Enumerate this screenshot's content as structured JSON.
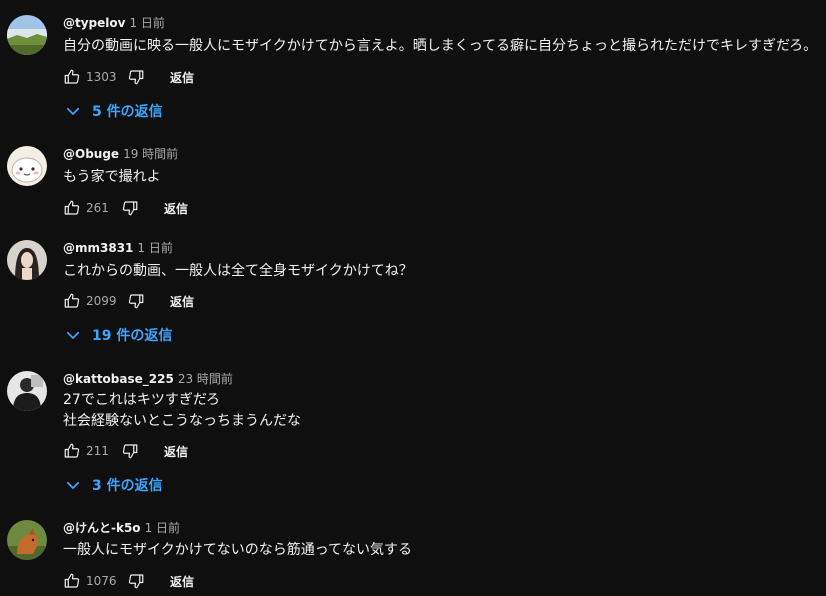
{
  "labels": {
    "reply": "返信"
  },
  "comments": [
    {
      "author": "@typelov",
      "time": "1 日前",
      "lines": [
        "自分の動画に映る一般人にモザイクかけてから言えよ。晒しまくってる癖に自分ちょっと撮られただけでキレすぎだろ。"
      ],
      "likes": "1303",
      "replies": "5 件の返信"
    },
    {
      "author": "@Obuge",
      "time": "19 時間前",
      "lines": [
        "もう家で撮れよ"
      ],
      "likes": "261"
    },
    {
      "author": "@mm3831",
      "time": "1 日前",
      "lines": [
        "これからの動画、一般人は全て全身モザイクかけてね？"
      ],
      "likes": "2099",
      "replies": "19 件の返信"
    },
    {
      "author": "@kattobase_225",
      "time": "23 時間前",
      "lines": [
        "27でこれはキツすぎだろ",
        "社会経験ないとこうなっちまうんだな"
      ],
      "likes": "211",
      "replies": "3 件の返信"
    },
    {
      "author": "@けんと-k5o",
      "time": "1 日前",
      "lines": [
        "一般人にモザイクかけてないのなら筋通ってない気する"
      ],
      "likes": "1076"
    }
  ]
}
